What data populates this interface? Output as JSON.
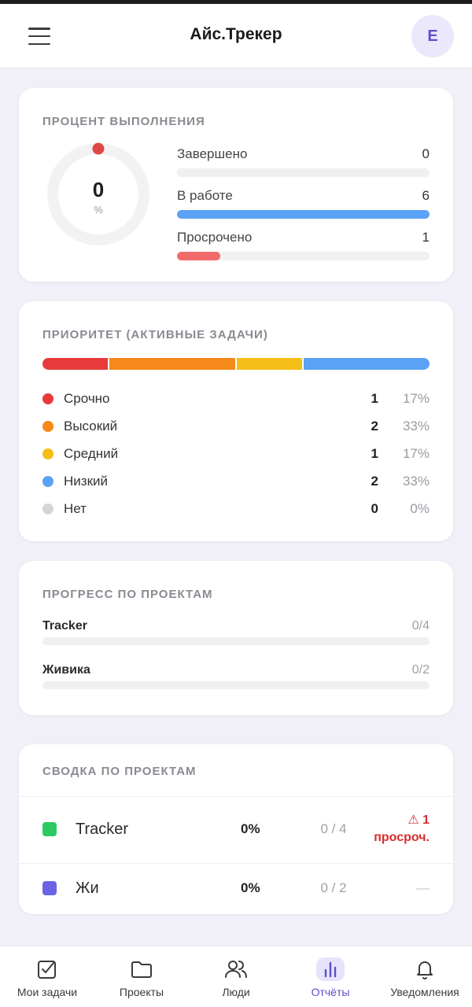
{
  "app": {
    "title": "Айс.Трекер",
    "avatar_initial": "E"
  },
  "colors": {
    "accent": "#5b4fc8",
    "blue": "#5aa2f5",
    "red": "#e83a3a",
    "orange": "#f5891a",
    "yellow": "#f5bd17",
    "gray": "#d5d5da",
    "overdue_bar": "#f26b6b",
    "green": "#2bcb62",
    "purple": "#6a63e6"
  },
  "completion": {
    "title": "ПРОЦЕНТ ВЫПОЛНЕНИЯ",
    "percent_value": "0",
    "percent_unit": "%",
    "percent_fraction": 0,
    "stats": [
      {
        "label": "Завершено",
        "count": "0",
        "fraction": 0,
        "color": "#5aa2f5"
      },
      {
        "label": "В работе",
        "count": "6",
        "fraction": 1.0,
        "color": "#5aa2f5"
      },
      {
        "label": "Просрочено",
        "count": "1",
        "fraction": 0.17,
        "color": "#f26b6b"
      }
    ]
  },
  "priority": {
    "title": "ПРИОРИТЕТ (АКТИВНЫЕ ЗАДАЧИ)",
    "items": [
      {
        "label": "Срочно",
        "count": "1",
        "pct": "17%",
        "share": 0.17,
        "color": "#e83a3a"
      },
      {
        "label": "Высокий",
        "count": "2",
        "pct": "33%",
        "share": 0.33,
        "color": "#f5891a"
      },
      {
        "label": "Средний",
        "count": "1",
        "pct": "17%",
        "share": 0.17,
        "color": "#f5bd17"
      },
      {
        "label": "Низкий",
        "count": "2",
        "pct": "33%",
        "share": 0.33,
        "color": "#5aa2f5"
      },
      {
        "label": "Нет",
        "count": "0",
        "pct": "0%",
        "share": 0,
        "color": "#d5d5da"
      }
    ]
  },
  "progress": {
    "title": "ПРОГРЕСС ПО ПРОЕКТАМ",
    "projects": [
      {
        "name": "Tracker",
        "ratio": "0/4",
        "fraction": 0
      },
      {
        "name": "Живика",
        "ratio": "0/2",
        "fraction": 0
      }
    ]
  },
  "summary": {
    "title": "СВОДКА ПО ПРОЕКТАМ",
    "rows": [
      {
        "name": "Tracker",
        "pct": "0%",
        "ratio": "0 / 4",
        "overdue_line1": "⚠ 1",
        "overdue_line2": "просроч.",
        "color": "#2bcb62"
      },
      {
        "name": "Жи",
        "pct": "0%",
        "ratio": "0 / 2",
        "none": "—",
        "color": "#6a63e6"
      }
    ]
  },
  "nav": {
    "items": [
      {
        "label": "Мои задачи",
        "icon": "checkbox-icon"
      },
      {
        "label": "Проекты",
        "icon": "folder-icon"
      },
      {
        "label": "Люди",
        "icon": "people-icon"
      },
      {
        "label": "Отчёты",
        "icon": "bar-chart-icon",
        "active": true
      },
      {
        "label": "Уведомления",
        "icon": "bell-icon"
      }
    ]
  }
}
